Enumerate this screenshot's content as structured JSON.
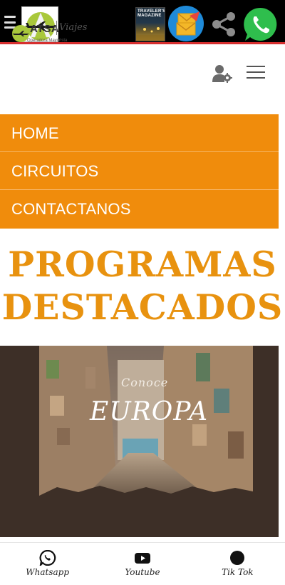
{
  "topbar": {
    "menu_icon": "menu-icon",
    "logo_icon": "atsa-plane-logo",
    "magazine_title": "TRAVELER'S MAGAZINE",
    "mail_icon": "envelope-icon",
    "share_icon": "share-icon",
    "whatsapp_icon": "whatsapp-icon",
    "accent_color": "#d62f2f"
  },
  "header": {
    "brand_name": "ATSA",
    "brand_tagline": "Viajes",
    "brand_sub": "Operadora Mayorista",
    "user_icon": "user-settings-icon",
    "hamburger_icon": "hamburger-icon"
  },
  "nav": {
    "color": "#f08c0c",
    "items": [
      "HOME",
      "CIRCUITOS",
      "CONTACTANOS"
    ]
  },
  "section": {
    "title_line1": "PROGRAMAS",
    "title_line2": "DESTACADOS",
    "color": "#e8920f"
  },
  "banner": {
    "kicker": "Conoce",
    "title": "EUROPA"
  },
  "bottom_nav": {
    "items": [
      {
        "label": "Whatsapp",
        "icon": "whatsapp-icon"
      },
      {
        "label": "Youtube",
        "icon": "youtube-icon"
      },
      {
        "label": "Tik Tok",
        "icon": "tiktok-icon"
      }
    ]
  }
}
